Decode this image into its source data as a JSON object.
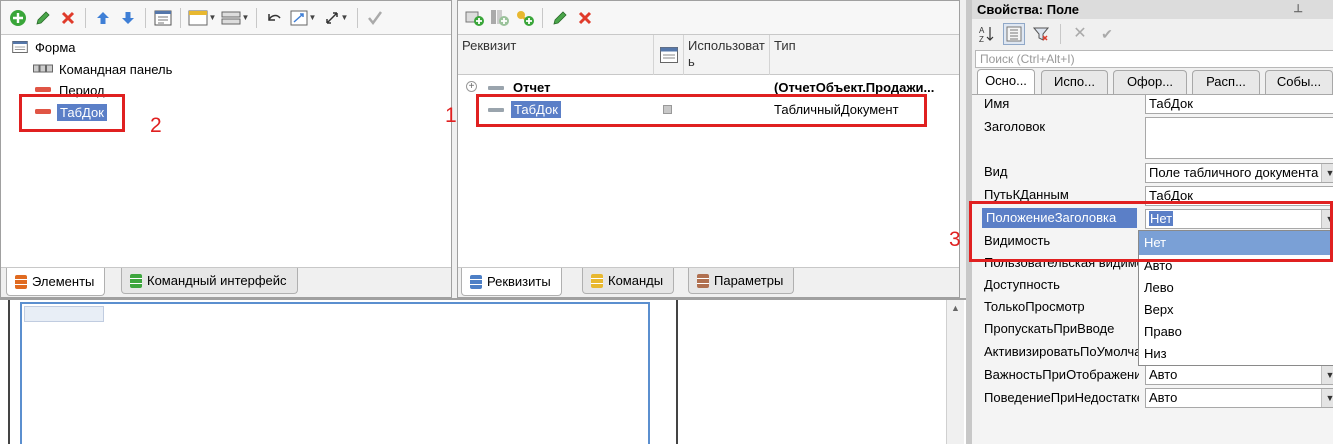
{
  "left_panel": {
    "tree": {
      "form": "Форма",
      "command_bar": "Командная панель",
      "period": "Период",
      "tabdoc": "ТабДок"
    },
    "tabs": {
      "elements": "Элементы",
      "command_interface": "Командный интерфейс"
    }
  },
  "mid_panel": {
    "columns": {
      "requisite": "Реквизит",
      "use": "Использовать",
      "type": "Тип"
    },
    "rows": {
      "otchet_name": "Отчет",
      "otchet_type": "(ОтчетОбъект.Продажи...",
      "tabdoc_name": "ТабДок",
      "tabdoc_type": "ТабличныйДокумент"
    },
    "tabs": {
      "requisites": "Реквизиты",
      "commands": "Команды",
      "parameters": "Параметры"
    }
  },
  "props_panel": {
    "title": "Свойства: Поле",
    "search_placeholder": "Поиск (Ctrl+Alt+I)",
    "tabs": [
      "Осно...",
      "Испо...",
      "Офор...",
      "Расп...",
      "Собы..."
    ],
    "labels": {
      "name": "Имя",
      "title": "Заголовок",
      "kind": "Вид",
      "data_path": "ПутьКДанным",
      "title_location": "ПоложениеЗаголовка",
      "visibility": "Видимость",
      "user_visibility": "Пользовательская видимость",
      "enabled": "Доступность",
      "read_only": "ТолькоПросмотр",
      "skip_on_input": "ПропускатьПриВводе",
      "activate_default": "АктивизироватьПоУмолчанию",
      "display_importance": "ВажностьПриОтображении",
      "not_enough_space": "ПоведениеПриНедостаткеМеста"
    },
    "values": {
      "name": "ТабДок",
      "title": "",
      "kind": "Поле табличного документа",
      "data_path": "ТабДок",
      "title_location": "Нет",
      "display_importance": "Авто",
      "not_enough_space": "Авто"
    },
    "dropdown_options": [
      "Нет",
      "Авто",
      "Лево",
      "Верх",
      "Право",
      "Низ"
    ]
  },
  "annotations": {
    "n1": "1",
    "n2": "2",
    "n3": "3",
    "color": "#e02020"
  },
  "colors": {
    "selection": "#5b7fc7",
    "dropdown_highlight": "#7aa0d6",
    "red_stripe": "#e05545",
    "add_icon": "#3aa63a",
    "delete_icon": "#e03b2b"
  }
}
